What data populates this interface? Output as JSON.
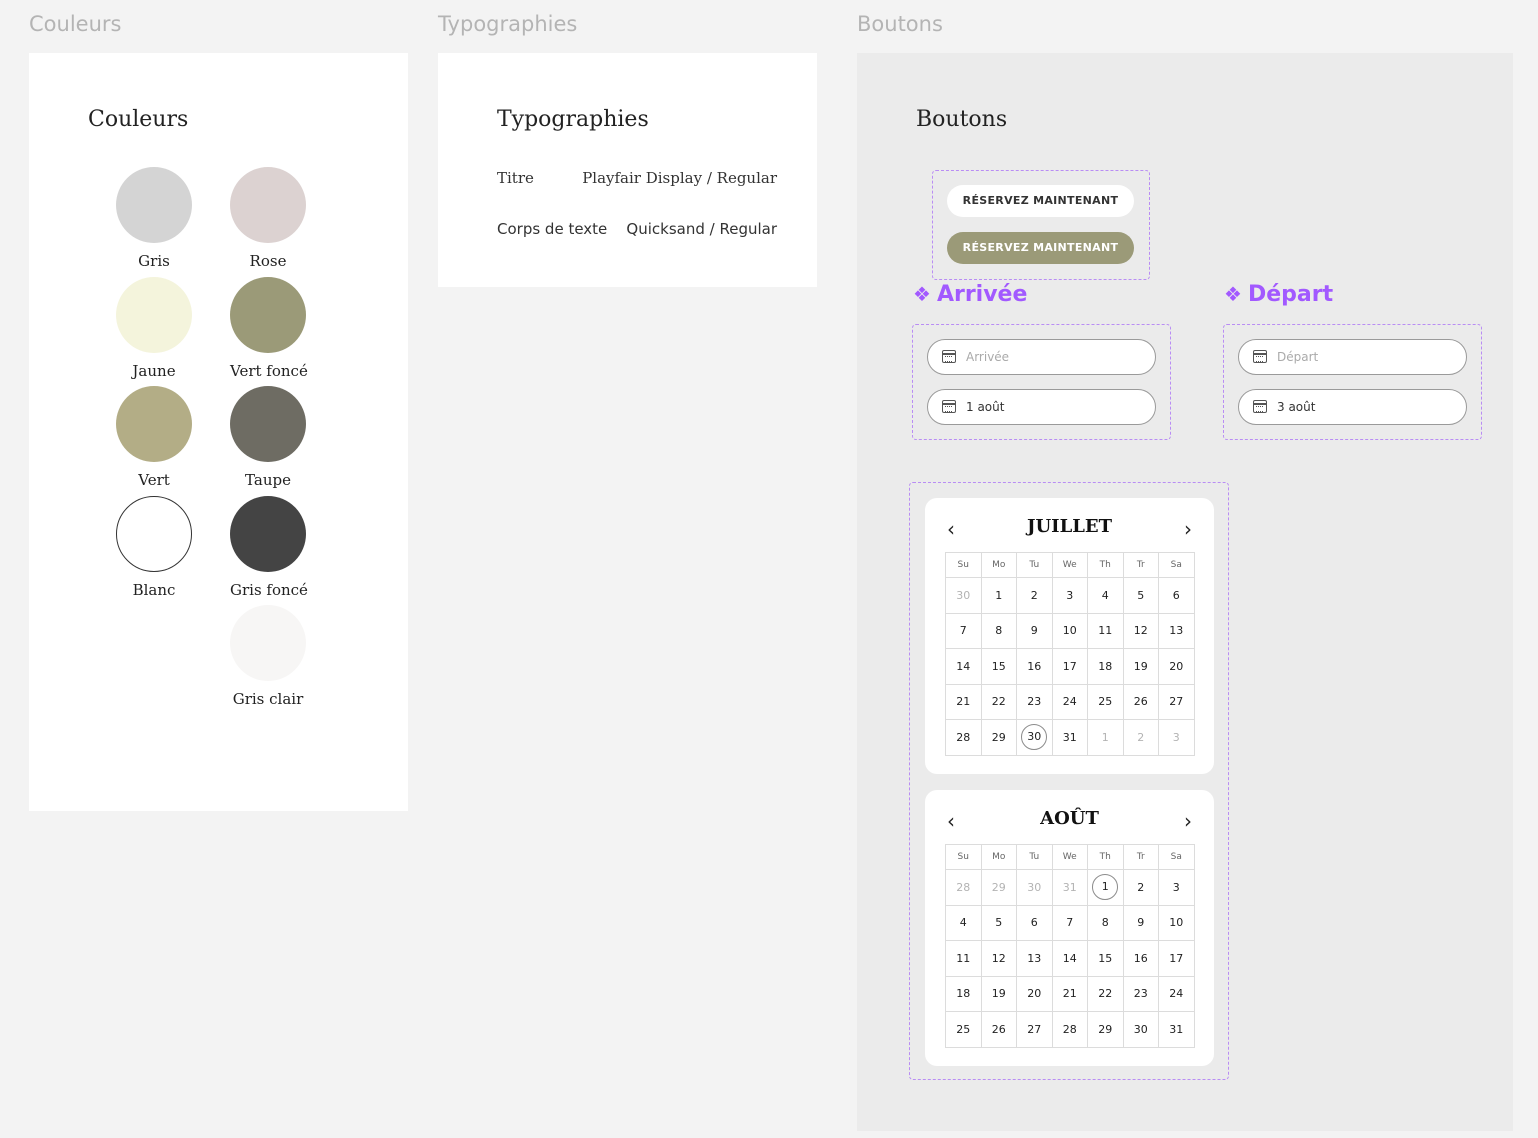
{
  "canvas": {
    "colors_frame_label": "Couleurs",
    "typography_frame_label": "Typographies",
    "buttons_frame_label": "Boutons"
  },
  "colors": {
    "title": "Couleurs",
    "swatches": [
      {
        "name": "Gris",
        "hex": "#d4d4d4"
      },
      {
        "name": "Rose",
        "hex": "#dcd2d1"
      },
      {
        "name": "Jaune",
        "hex": "#f4f4dc"
      },
      {
        "name": "Vert foncé",
        "hex": "#9b9a78"
      },
      {
        "name": "Vert",
        "hex": "#b3ad86"
      },
      {
        "name": "Taupe",
        "hex": "#6e6c63"
      },
      {
        "name": "Blanc",
        "hex": "#ffffff"
      },
      {
        "name": "Gris foncé",
        "hex": "#444444"
      },
      {
        "name": "Gris clair",
        "hex": "#f7f6f5"
      }
    ]
  },
  "typography": {
    "title": "Typographies",
    "rows": [
      {
        "name": "Titre",
        "value": "Playfair Display / Regular"
      },
      {
        "name": "Corps de texte",
        "value": "Quicksand / Regular"
      }
    ]
  },
  "buttons": {
    "title": "Boutons",
    "primary_white_label": "RÉSERVEZ MAINTENANT",
    "primary_green_label": "RÉSERVEZ MAINTENANT",
    "arrival": {
      "component_label": "Arrivée",
      "placeholder": "Arrivée",
      "value": "1 août"
    },
    "departure": {
      "component_label": "Départ",
      "placeholder": "Départ",
      "value": "3 août"
    }
  },
  "calendars": [
    {
      "month": "JUILLET",
      "weekdays": [
        "Su",
        "Mo",
        "Tu",
        "We",
        "Th",
        "Tr",
        "Sa"
      ],
      "weeks": [
        [
          "30",
          "1",
          "2",
          "3",
          "4",
          "5",
          "6"
        ],
        [
          "7",
          "8",
          "9",
          "10",
          "11",
          "12",
          "13"
        ],
        [
          "14",
          "15",
          "16",
          "17",
          "18",
          "19",
          "20"
        ],
        [
          "21",
          "22",
          "23",
          "24",
          "25",
          "26",
          "27"
        ],
        [
          "28",
          "29",
          "30",
          "31",
          "1",
          "2",
          "3"
        ]
      ],
      "muted_cells": [
        [
          0,
          0
        ],
        [
          4,
          4
        ],
        [
          4,
          5
        ],
        [
          4,
          6
        ]
      ],
      "circled_cells": [
        [
          4,
          2
        ]
      ]
    },
    {
      "month": "AOÛT",
      "weekdays": [
        "Su",
        "Mo",
        "Tu",
        "We",
        "Th",
        "Tr",
        "Sa"
      ],
      "weeks": [
        [
          "28",
          "29",
          "30",
          "31",
          "1",
          "2",
          "3"
        ],
        [
          "4",
          "5",
          "6",
          "7",
          "8",
          "9",
          "10"
        ],
        [
          "11",
          "12",
          "13",
          "14",
          "15",
          "16",
          "17"
        ],
        [
          "18",
          "19",
          "20",
          "21",
          "22",
          "23",
          "24"
        ],
        [
          "25",
          "26",
          "27",
          "28",
          "29",
          "30",
          "31"
        ]
      ],
      "muted_cells": [
        [
          0,
          0
        ],
        [
          0,
          1
        ],
        [
          0,
          2
        ],
        [
          0,
          3
        ]
      ],
      "circled_cells": [
        [
          0,
          4
        ]
      ]
    }
  ],
  "icons": {
    "component": "component-diamond-icon",
    "calendar": "calendar-icon",
    "prev": "chevron-left-icon",
    "next": "chevron-right-icon"
  }
}
